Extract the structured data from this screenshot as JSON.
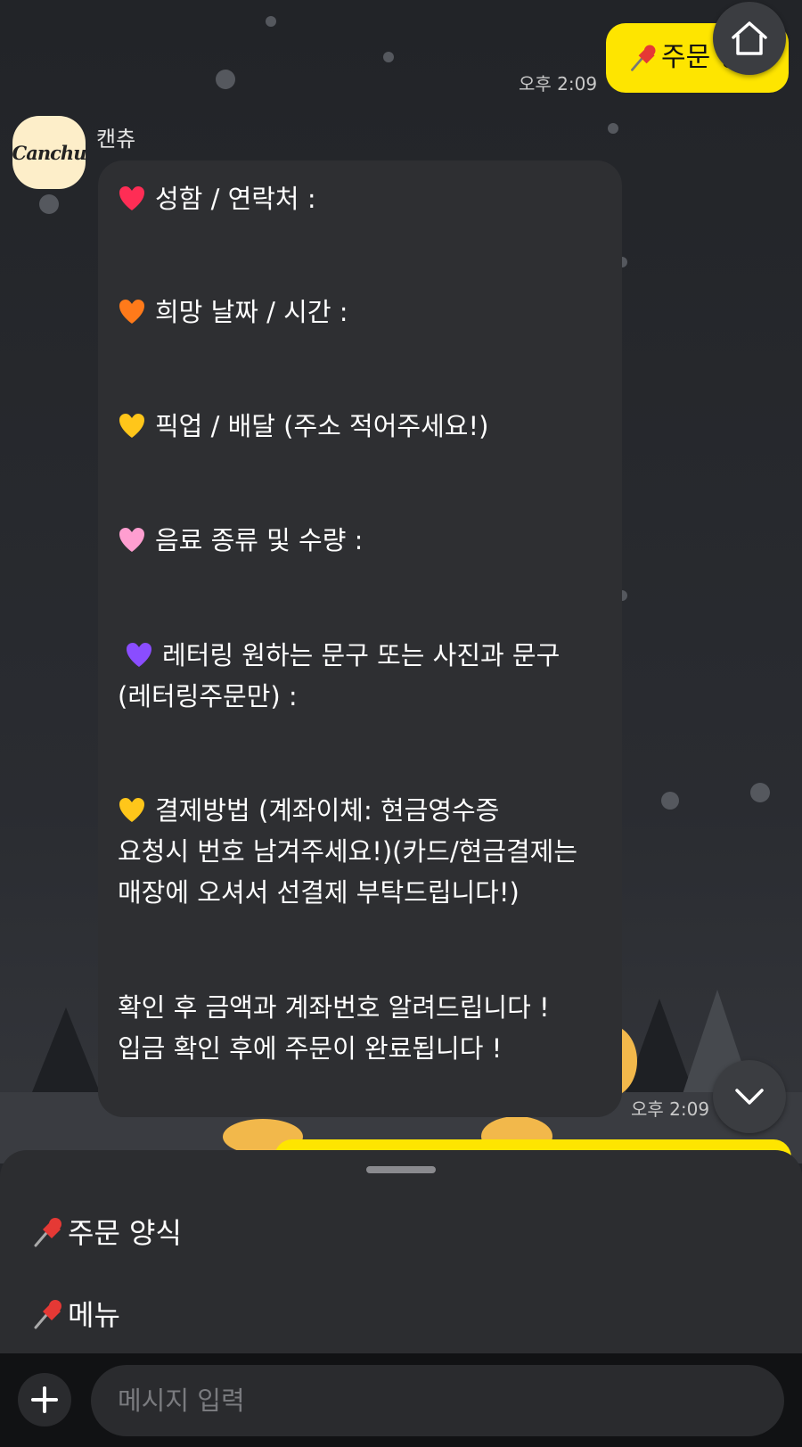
{
  "chat": {
    "sent_message": {
      "text": "주문 양식",
      "time": "오후 2:09"
    },
    "sender_name": "캔츄",
    "avatar_text": "Canchu",
    "received_message": {
      "lines": [
        "성함 / 연락처 :",
        "희망 날짜 / 시간 :",
        "픽업 / 배달 (주소 적어주세요!)",
        "음료 종류 및 수량 :",
        "레터링 원하는 문구 또는 사진과 문구",
        "(레터링주문만) :",
        "결제방법 (계좌이체: 현금영수증",
        "요청시 번호 남겨주세요!)(카드/현금결제는",
        "매장에 오셔서 선결제 부탁드립니다!)",
        "확인 후 금액과 계좌번호 알려드립니다 !",
        "입금 확인 후에 주문이 완료됩니다 !"
      ],
      "time": "오후 2:09"
    },
    "heart_colors": [
      "#ff2d55",
      "#ff7a1a",
      "#ffc61a",
      "#ff9ed0",
      "#8a4dff",
      "#ffc61a"
    ]
  },
  "quick_menu": {
    "items": [
      "주문 양식",
      "메뉴"
    ]
  },
  "input": {
    "placeholder": "메시지 입력"
  },
  "icons": {
    "home": "home-icon",
    "down": "chevron-down-icon",
    "plus": "plus-icon",
    "pin": "pushpin-icon"
  }
}
